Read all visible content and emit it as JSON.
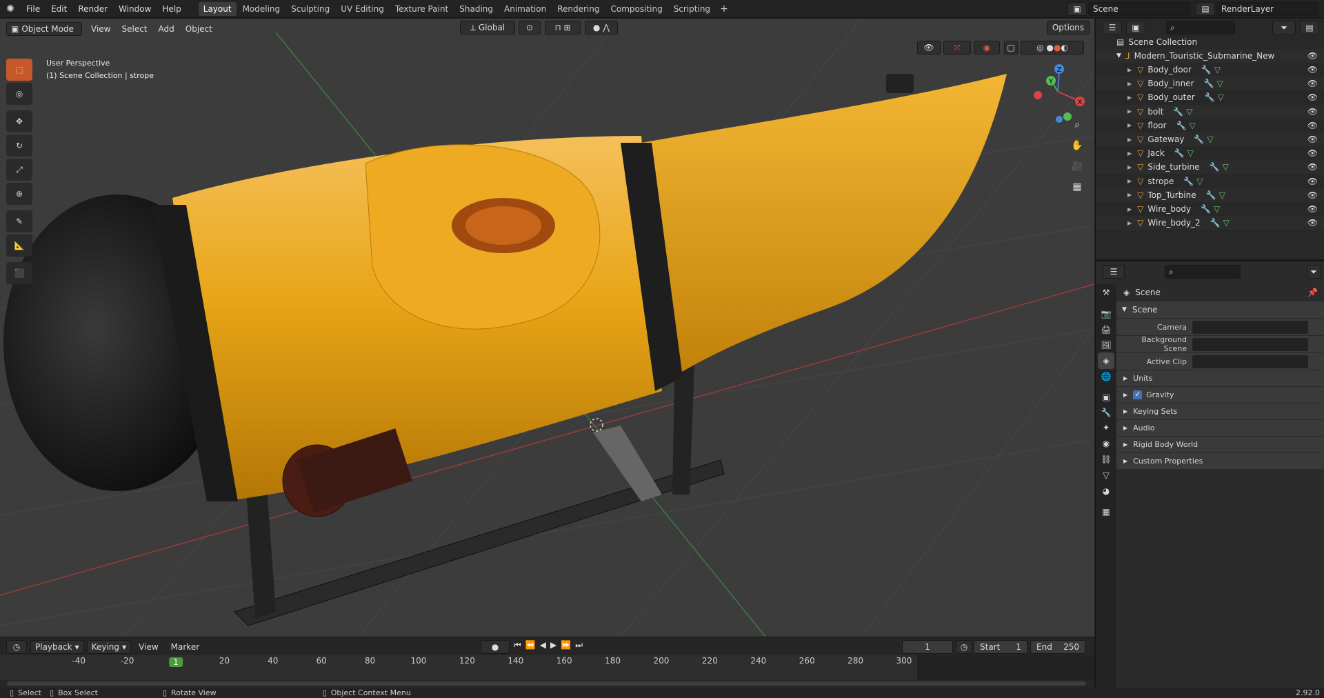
{
  "menus": [
    "File",
    "Edit",
    "Render",
    "Window",
    "Help"
  ],
  "workspaces": [
    "Layout",
    "Modeling",
    "Sculpting",
    "UV Editing",
    "Texture Paint",
    "Shading",
    "Animation",
    "Rendering",
    "Compositing",
    "Scripting"
  ],
  "active_workspace": "Layout",
  "scene_name": "Scene",
  "render_layer": "RenderLayer",
  "viewport": {
    "mode": "Object Mode",
    "menus": [
      "View",
      "Select",
      "Add",
      "Object"
    ],
    "transform_orientation": "Global",
    "options": "Options",
    "perspective": "User Perspective",
    "collection_info": "(1) Scene Collection | strope"
  },
  "outliner": {
    "root": "Scene Collection",
    "collection": "Modern_Touristic_Submarine_New",
    "objects": [
      "Body_door",
      "Body_inner",
      "Body_outer",
      "bolt",
      "floor",
      "Gateway",
      "Jack",
      "Side_turbine",
      "strope",
      "Top_Turbine",
      "Wire_body",
      "Wire_body_2"
    ]
  },
  "properties": {
    "context": "Scene",
    "panel": "Scene",
    "fields": [
      {
        "label": "Camera"
      },
      {
        "label": "Background Scene"
      },
      {
        "label": "Active Clip"
      }
    ],
    "subpanels": [
      "Units",
      "Gravity",
      "Keying Sets",
      "Audio",
      "Rigid Body World",
      "Custom Properties"
    ],
    "gravity_checked": true
  },
  "timeline": {
    "menus": [
      "Playback",
      "Keying",
      "View",
      "Marker"
    ],
    "current_frame": "1",
    "start_label": "Start",
    "start": "1",
    "end_label": "End",
    "end": "250",
    "ticks": [
      "-40",
      "-20",
      "1",
      "20",
      "40",
      "60",
      "80",
      "100",
      "120",
      "140",
      "160",
      "180",
      "200",
      "220",
      "240",
      "260",
      "280",
      "300"
    ]
  },
  "statusbar": {
    "select": "Select",
    "box_select": "Box Select",
    "rotate_view": "Rotate View",
    "context_menu": "Object Context Menu",
    "version": "2.92.0"
  },
  "axes": {
    "x": "X",
    "y": "Y",
    "z": "Z"
  }
}
